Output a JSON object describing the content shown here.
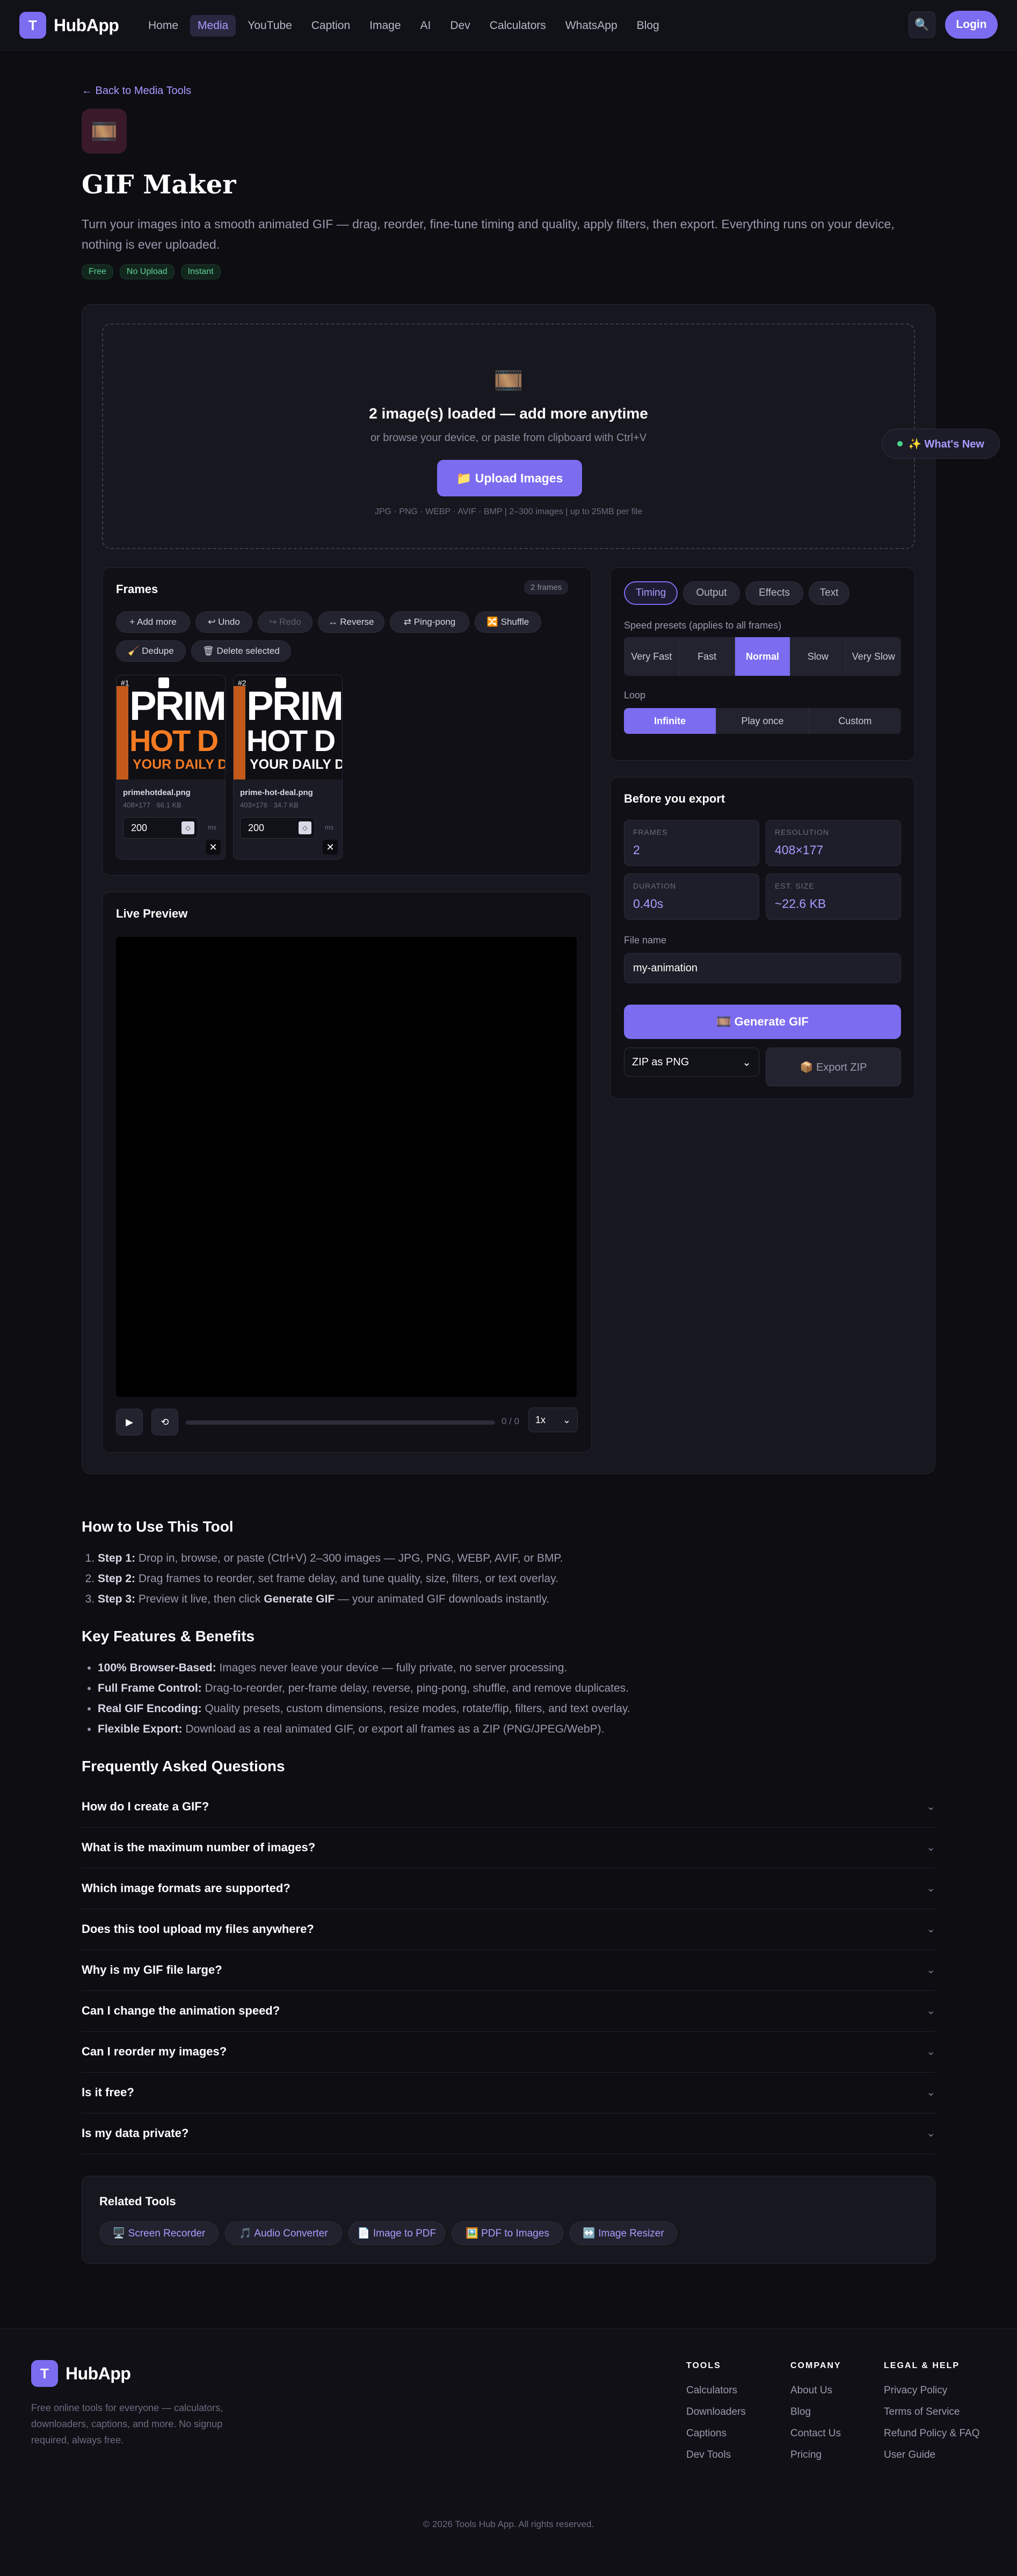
{
  "nav": {
    "brand_badge": "T",
    "brand": "HubApp",
    "links": [
      "Home",
      "Media",
      "YouTube",
      "Caption",
      "Image",
      "AI",
      "Dev",
      "Calculators",
      "WhatsApp",
      "Blog"
    ],
    "active": "Media",
    "search_icon": "🔍",
    "login": "Login"
  },
  "header": {
    "back": "← Back to Media Tools",
    "icon": "🎞️",
    "title": "GIF Maker",
    "description": "Turn your images into a smooth animated GIF — drag, reorder, fine-tune timing and quality, apply filters, then export. Everything runs on your device, nothing is ever uploaded.",
    "badges": [
      "Free",
      "No Upload",
      "Instant"
    ]
  },
  "dropzone": {
    "icon": "🎞️",
    "title": "2 image(s) loaded — add more anytime",
    "subtitle": "or browse your device, or paste from clipboard with Ctrl+V",
    "button": "📁 Upload Images",
    "formats": "JPG · PNG · WEBP · AVIF · BMP  |  2–300 images  |  up to 25MB per file"
  },
  "whats_new": "✨ What's New",
  "frames": {
    "title": "Frames",
    "count": "2 frames",
    "actions": [
      "+ Add more",
      "↩ Undo",
      "↪ Redo",
      "↔ Reverse",
      "⇄ Ping-pong",
      "🔀 Shuffle",
      "🧹 Dedupe",
      "🗑 Delete selected"
    ],
    "items": [
      {
        "num": "#1",
        "line1": "PRIM",
        "line2": "HOT D",
        "line3": "YOUR DAILY D",
        "name": "primehotdeal.png",
        "meta": "408×177 · 66.1 KB",
        "delay": "200",
        "unit": "ms"
      },
      {
        "num": "#2",
        "line1": "PRIM",
        "line2": "HOT D",
        "line3": "YOUR DAILY D",
        "name": "prime-hot-deal.png",
        "meta": "403×176 · 34.7 KB",
        "delay": "200",
        "unit": "ms"
      }
    ]
  },
  "preview": {
    "title": "Live Preview",
    "play_icon": "▶",
    "loop_icon": "⟲",
    "time": "0 / 0",
    "speed": "1x"
  },
  "settings": {
    "tabs": [
      "Timing",
      "Output",
      "Effects",
      "Text"
    ],
    "active_tab": "Timing",
    "speed_label": "Speed presets (applies to all frames)",
    "speed_presets": [
      "Very Fast",
      "Fast",
      "Normal",
      "Slow",
      "Very Slow"
    ],
    "speed_active": "Normal",
    "loop_label": "Loop",
    "loop_options": [
      "Infinite",
      "Play once",
      "Custom"
    ],
    "loop_active": "Infinite"
  },
  "export": {
    "title": "Before you export",
    "stats": [
      {
        "key": "FRAMES",
        "value": "2"
      },
      {
        "key": "RESOLUTION",
        "value": "408×177"
      },
      {
        "key": "DURATION",
        "value": "0.40s"
      },
      {
        "key": "EST. SIZE",
        "value": "~22.6 KB"
      }
    ],
    "filename_label": "File name",
    "filename": "my-animation",
    "generate": "🎞️ Generate GIF",
    "zip_format": "ZIP as PNG",
    "export_zip": "📦 Export ZIP"
  },
  "howto": {
    "title": "How to Use This Tool",
    "steps": [
      {
        "b": "Step 1:",
        "t": " Drop in, browse, or paste (Ctrl+V) 2–300 images — JPG, PNG, WEBP, AVIF, or BMP."
      },
      {
        "b": "Step 2:",
        "t": " Drag frames to reorder, set frame delay, and tune quality, size, filters, or text overlay."
      },
      {
        "b": "Step 3:",
        "t": " Preview it live, then click ",
        "b2": "Generate GIF",
        "t2": " — your animated GIF downloads instantly."
      }
    ]
  },
  "features": {
    "title": "Key Features & Benefits",
    "items": [
      {
        "b": "100% Browser-Based:",
        "t": " Images never leave your device — fully private, no server processing."
      },
      {
        "b": "Full Frame Control:",
        "t": " Drag-to-reorder, per-frame delay, reverse, ping-pong, shuffle, and remove duplicates."
      },
      {
        "b": "Real GIF Encoding:",
        "t": " Quality presets, custom dimensions, resize modes, rotate/flip, filters, and text overlay."
      },
      {
        "b": "Flexible Export:",
        "t": " Download as a real animated GIF, or export all frames as a ZIP (PNG/JPEG/WebP)."
      }
    ]
  },
  "faq": {
    "title": "Frequently Asked Questions",
    "chevron": "⌄",
    "items": [
      "How do I create a GIF?",
      "What is the maximum number of images?",
      "Which image formats are supported?",
      "Does this tool upload my files anywhere?",
      "Why is my GIF file large?",
      "Can I change the animation speed?",
      "Can I reorder my images?",
      "Is it free?",
      "Is my data private?"
    ]
  },
  "related": {
    "title": "Related Tools",
    "items": [
      "🖥️ Screen Recorder",
      "🎵 Audio Converter",
      "📄 Image to PDF",
      "🖼️ PDF to Images",
      "↔️ Image Resizer"
    ]
  },
  "footer": {
    "brand_badge": "T",
    "brand": "HubApp",
    "description": "Free online tools for everyone — calculators, downloaders, captions, and more. No signup required, always free.",
    "columns": [
      {
        "heading": "TOOLS",
        "links": [
          "Calculators",
          "Downloaders",
          "Captions",
          "Dev Tools"
        ]
      },
      {
        "heading": "COMPANY",
        "links": [
          "About Us",
          "Blog",
          "Contact Us",
          "Pricing"
        ]
      },
      {
        "heading": "LEGAL & HELP",
        "links": [
          "Privacy Policy",
          "Terms of Service",
          "Refund Policy & FAQ",
          "User Guide"
        ]
      }
    ],
    "copyright": "© 2026 Tools Hub App. All rights reserved."
  },
  "colors": {
    "accent": "#7c6cf0",
    "background": "#0d0d12",
    "success": "#5fd39a"
  }
}
